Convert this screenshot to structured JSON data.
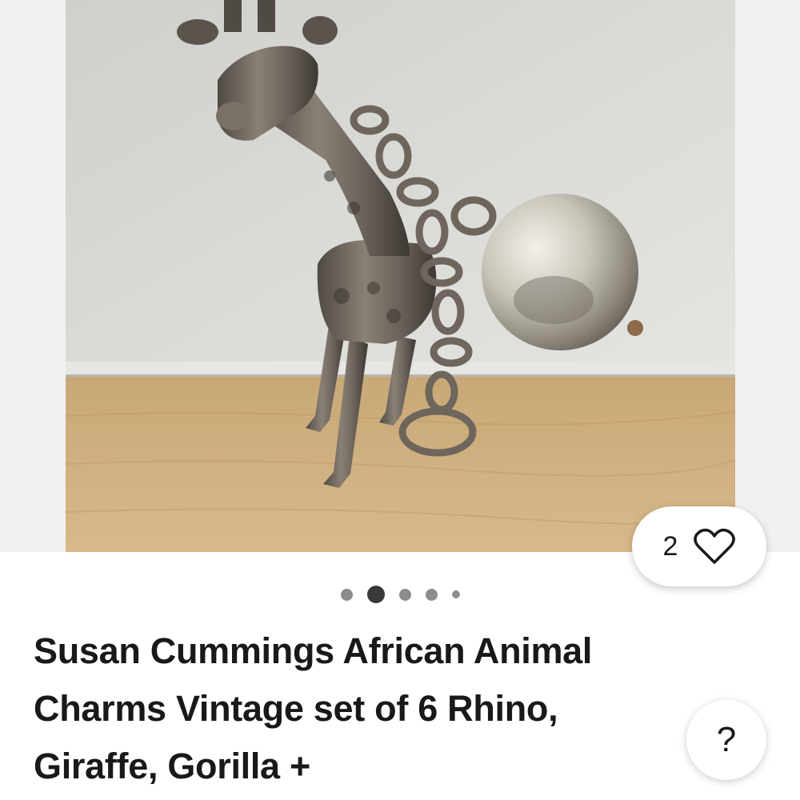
{
  "listing": {
    "title": "Susan Cummings African Animal Charms Vintage set of 6 Rhino, Giraffe, Gorilla +",
    "image_alt": "Silver giraffe charm with pearl ball on chain"
  },
  "watchers": {
    "count": "2",
    "icon": "heart-outline-icon"
  },
  "gallery": {
    "total_images": 5,
    "active_index": 1
  },
  "help": {
    "label": "?"
  },
  "colors": {
    "text": "#191919",
    "dot_active": "#3a3a3a",
    "dot_inactive": "#8c8c8c",
    "gallery_bg": "#f1f1f1"
  }
}
